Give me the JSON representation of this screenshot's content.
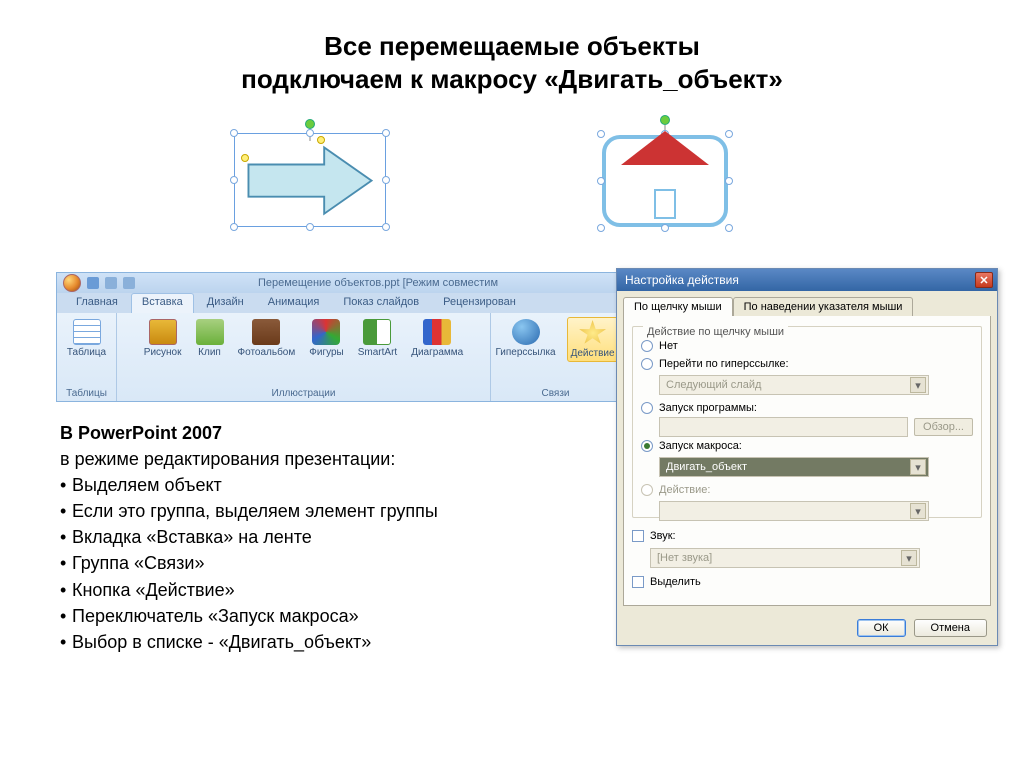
{
  "title_line1": "Все перемещаемые объекты",
  "title_line2": "подключаем к макросу «Двигать_объект»",
  "ribbon": {
    "doc_title": "Перемещение объектов.ppt [Режим совместим",
    "tabs": [
      "Главная",
      "Вставка",
      "Дизайн",
      "Анимация",
      "Показ слайдов",
      "Рецензирован"
    ],
    "group_tables": "Таблицы",
    "group_illustrations": "Иллюстрации",
    "group_links": "Связи",
    "btn_table": "Таблица",
    "btn_picture": "Рисунок",
    "btn_clip": "Клип",
    "btn_album": "Фотоальбом",
    "btn_shapes": "Фигуры",
    "btn_smartart": "SmartArt",
    "btn_chart": "Диаграмма",
    "btn_hyperlink": "Гиперссылка",
    "btn_action": "Действие"
  },
  "dialog": {
    "title": "Настройка действия",
    "tab_click": "По щелчку мыши",
    "tab_hover": "По наведении указателя мыши",
    "group_label": "Действие по щелчку мыши",
    "opt_none": "Нет",
    "opt_hyperlink": "Перейти по гиперссылке:",
    "combo_hyperlink": "Следующий слайд",
    "opt_run_program": "Запуск программы:",
    "browse": "Обзор...",
    "opt_run_macro": "Запуск макроса:",
    "combo_macro": "Двигать_объект",
    "opt_object_action": "Действие:",
    "chk_sound": "Звук:",
    "combo_sound": "[Нет звука]",
    "chk_highlight": "Выделить",
    "btn_ok": "ОК",
    "btn_cancel": "Отмена"
  },
  "instructions": {
    "heading": "В PowerPoint 2007",
    "subheading": "в режиме редактирования презентации:",
    "items": [
      "Выделяем объект",
      "Если это группа, выделяем элемент группы",
      "Вкладка «Вставка» на ленте",
      "Группа «Связи»",
      "Кнопка «Действие»",
      "Переключатель «Запуск макроса»",
      "Выбор в списке - «Двигать_объект»"
    ]
  }
}
